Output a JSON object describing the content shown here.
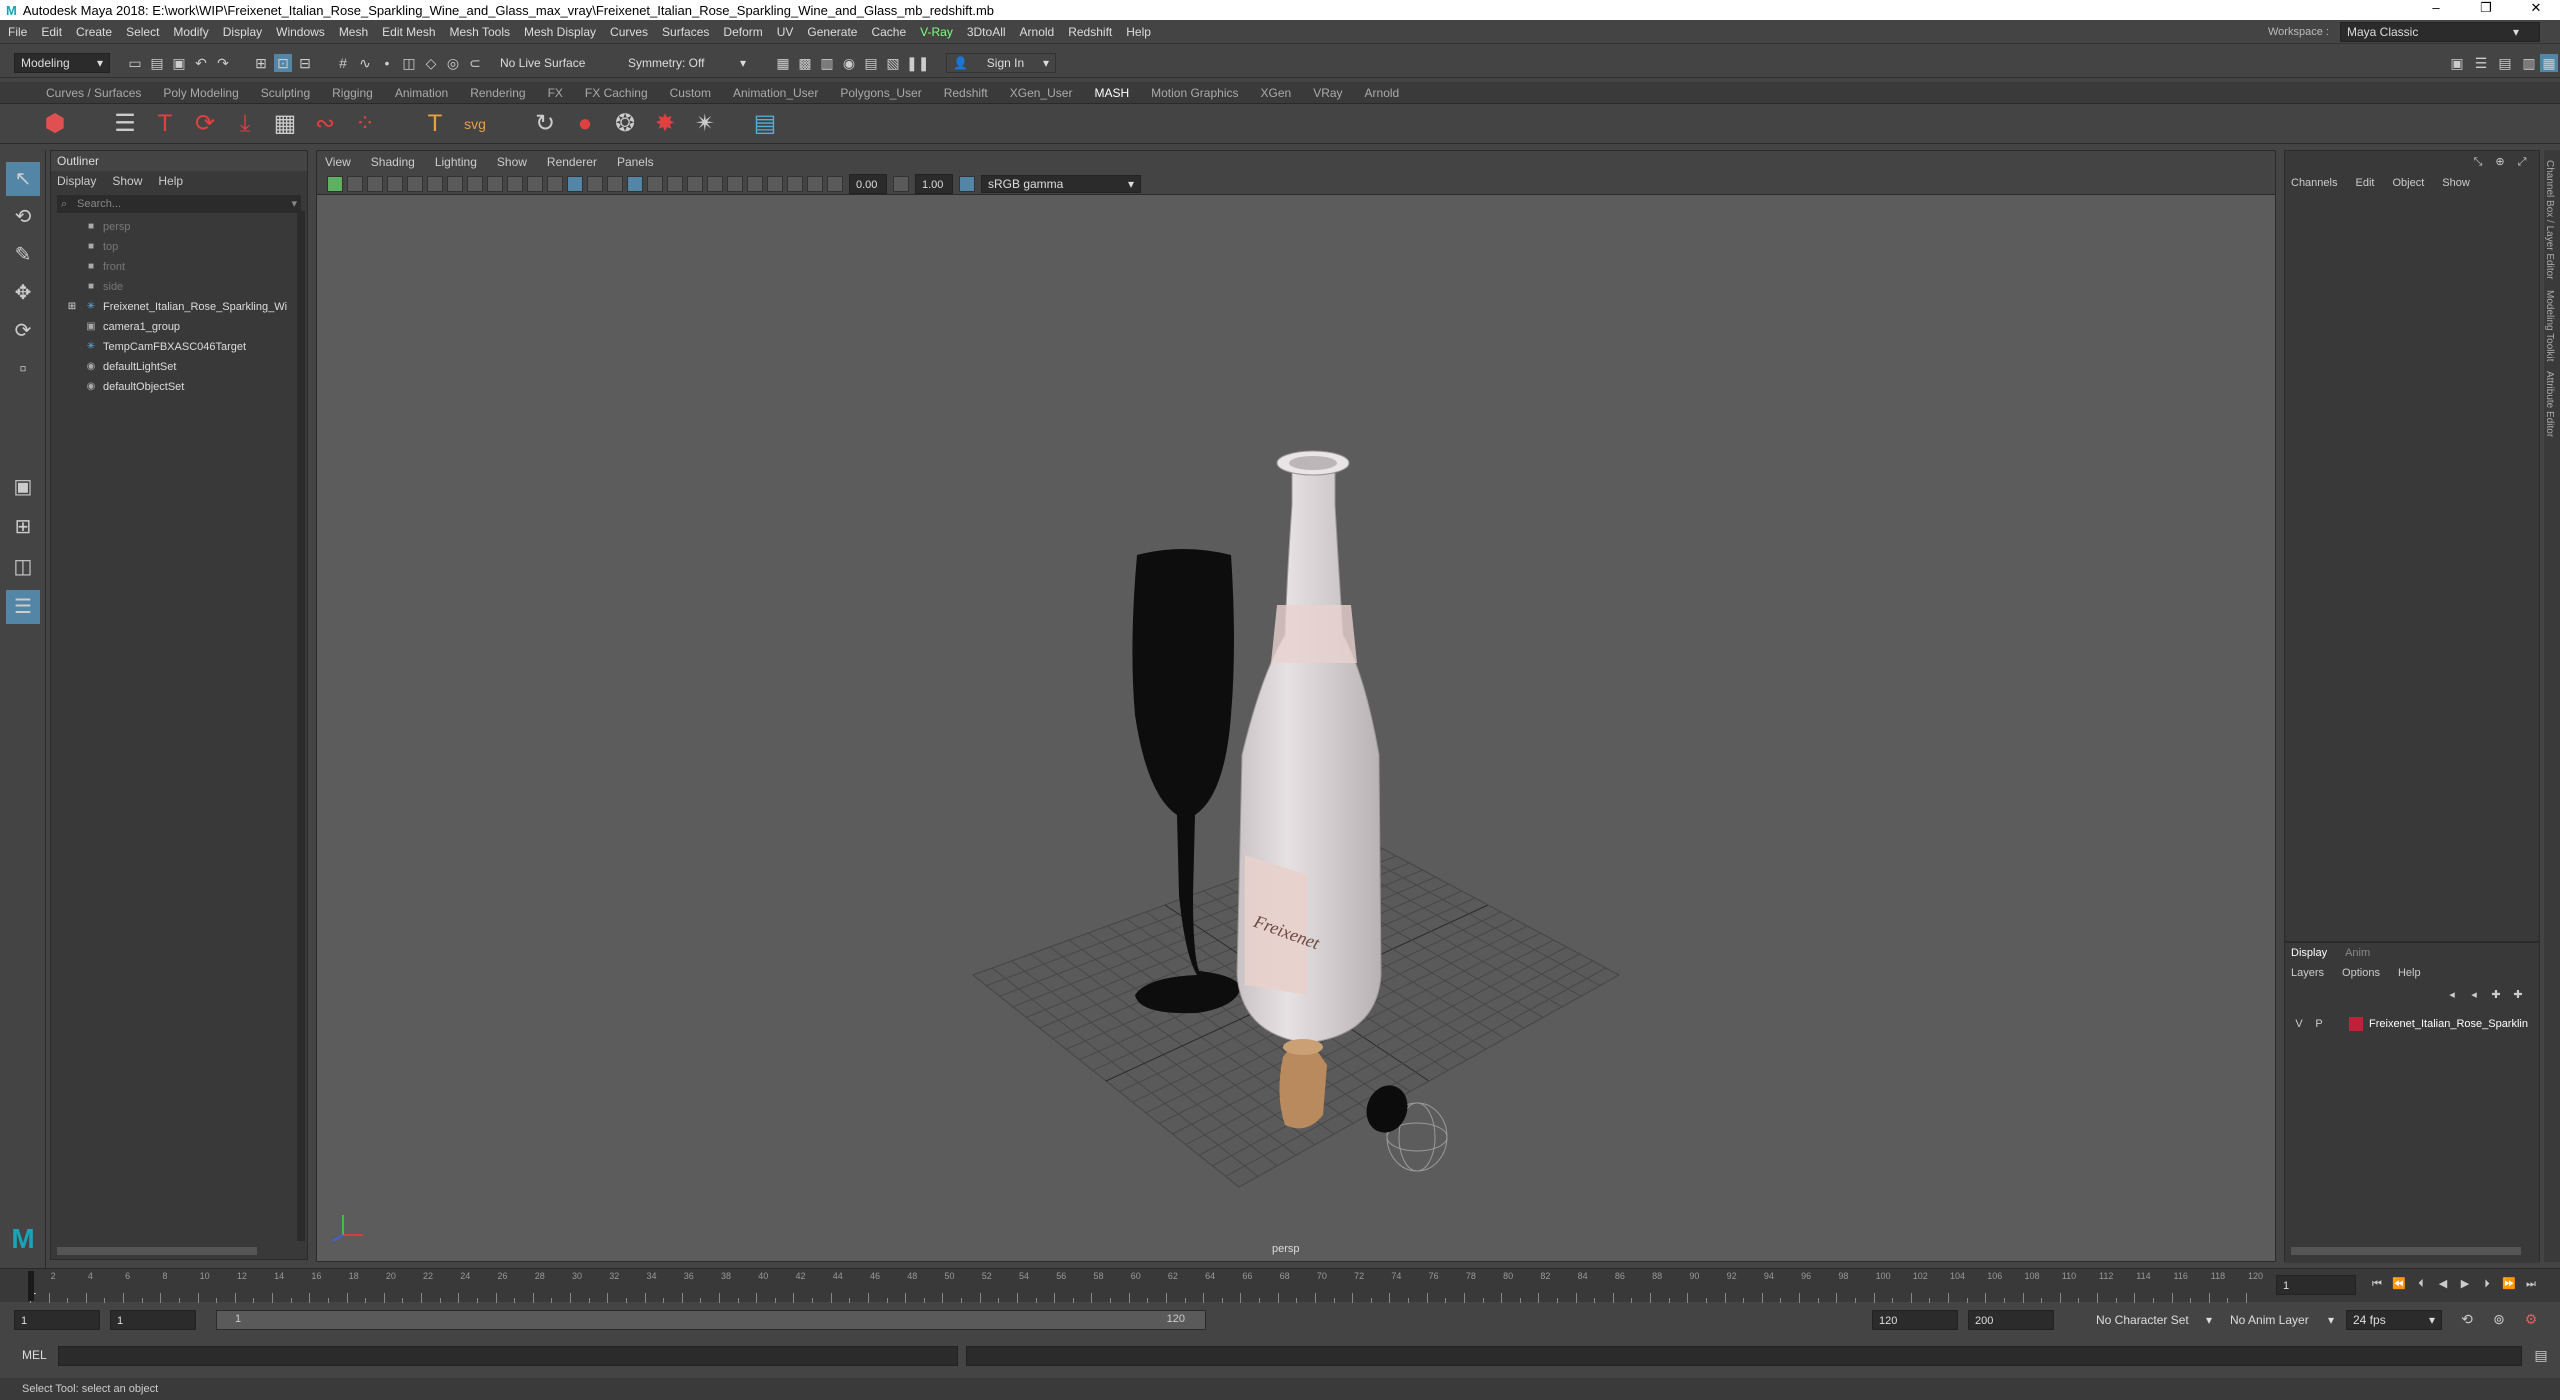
{
  "window": {
    "title": "Autodesk Maya 2018: E:\\work\\WIP\\Freixenet_Italian_Rose_Sparkling_Wine_and_Glass_max_vray\\Freixenet_Italian_Rose_Sparkling_Wine_and_Glass_mb_redshift.mb"
  },
  "menubar": {
    "items": [
      "File",
      "Edit",
      "Create",
      "Select",
      "Modify",
      "Display",
      "Windows",
      "Mesh",
      "Edit Mesh",
      "Mesh Tools",
      "Mesh Display",
      "Curves",
      "Surfaces",
      "Deform",
      "UV",
      "Generate",
      "Cache",
      "V-Ray",
      "3DtoAll",
      "Arnold",
      "Redshift",
      "Help"
    ],
    "workspace_label": "Workspace :",
    "workspace_value": "Maya Classic"
  },
  "statusline": {
    "mode": "Modeling",
    "live_surface": "No Live Surface",
    "symmetry": "Symmetry: Off",
    "sign_in": "Sign In"
  },
  "shelf": {
    "tabs": [
      "Curves / Surfaces",
      "Poly Modeling",
      "Sculpting",
      "Rigging",
      "Animation",
      "Rendering",
      "FX",
      "FX Caching",
      "Custom",
      "Animation_User",
      "Polygons_User",
      "Redshift",
      "XGen_User",
      "MASH",
      "Motion Graphics",
      "XGen",
      "VRay",
      "Arnold"
    ],
    "active_tab": "MASH"
  },
  "outliner": {
    "title": "Outliner",
    "menu": [
      "Display",
      "Show",
      "Help"
    ],
    "search_placeholder": "Search...",
    "items": [
      {
        "label": "persp",
        "dim": true,
        "icon": "camera-icon"
      },
      {
        "label": "top",
        "dim": true,
        "icon": "camera-icon"
      },
      {
        "label": "front",
        "dim": true,
        "icon": "camera-icon"
      },
      {
        "label": "side",
        "dim": true,
        "icon": "camera-icon"
      },
      {
        "label": "Freixenet_Italian_Rose_Sparkling_Wi",
        "dim": false,
        "icon": "group-icon",
        "expand": true
      },
      {
        "label": "camera1_group",
        "dim": false,
        "icon": "camera-group-icon"
      },
      {
        "label": "TempCamFBXASC046Target",
        "dim": false,
        "icon": "locator-icon"
      },
      {
        "label": "defaultLightSet",
        "dim": false,
        "icon": "set-icon"
      },
      {
        "label": "defaultObjectSet",
        "dim": false,
        "icon": "set-icon"
      }
    ]
  },
  "viewport": {
    "menu": [
      "View",
      "Shading",
      "Lighting",
      "Show",
      "Renderer",
      "Panels"
    ],
    "exposure": "0.00",
    "gamma": "1.00",
    "colorspace": "sRGB gamma",
    "camera_label": "persp",
    "bottle_label": "Freixenet"
  },
  "channelbox": {
    "menu": [
      "Channels",
      "Edit",
      "Object",
      "Show"
    ],
    "layer_tabs": [
      "Display",
      "Anim"
    ],
    "layer_menu": [
      "Layers",
      "Options",
      "Help"
    ],
    "layer": {
      "v": "V",
      "p": "P",
      "name": "Freixenet_Italian_Rose_Sparklin",
      "color": "#c0203a"
    }
  },
  "sidetabs": [
    "Channel Box / Layer Editor",
    "Modeling Toolkit",
    "Attribute Editor"
  ],
  "timeline": {
    "ticks": [
      "2",
      "4",
      "6",
      "8",
      "10",
      "12",
      "14",
      "16",
      "18",
      "20",
      "22",
      "24",
      "26",
      "28",
      "30",
      "32",
      "34",
      "36",
      "38",
      "40",
      "42",
      "44",
      "46",
      "48",
      "50",
      "52",
      "54",
      "56",
      "58",
      "60",
      "62",
      "64",
      "66",
      "68",
      "70",
      "72",
      "74",
      "76",
      "78",
      "80",
      "82",
      "84",
      "86",
      "88",
      "90",
      "92",
      "94",
      "96",
      "98",
      "100",
      "102",
      "104",
      "106",
      "108",
      "110",
      "112",
      "114",
      "116",
      "118",
      "120"
    ],
    "start_marker": "1",
    "current_frame": "1"
  },
  "rangebar": {
    "start": "1",
    "anim_start": "1",
    "range_start": "1",
    "range_end": "120",
    "end": "120",
    "anim_end": "200",
    "character_set": "No Character Set",
    "anim_layer": "No Anim Layer",
    "fps": "24 fps"
  },
  "cmdline": {
    "label": "MEL"
  },
  "helpline": {
    "text": "Select Tool: select an object"
  }
}
